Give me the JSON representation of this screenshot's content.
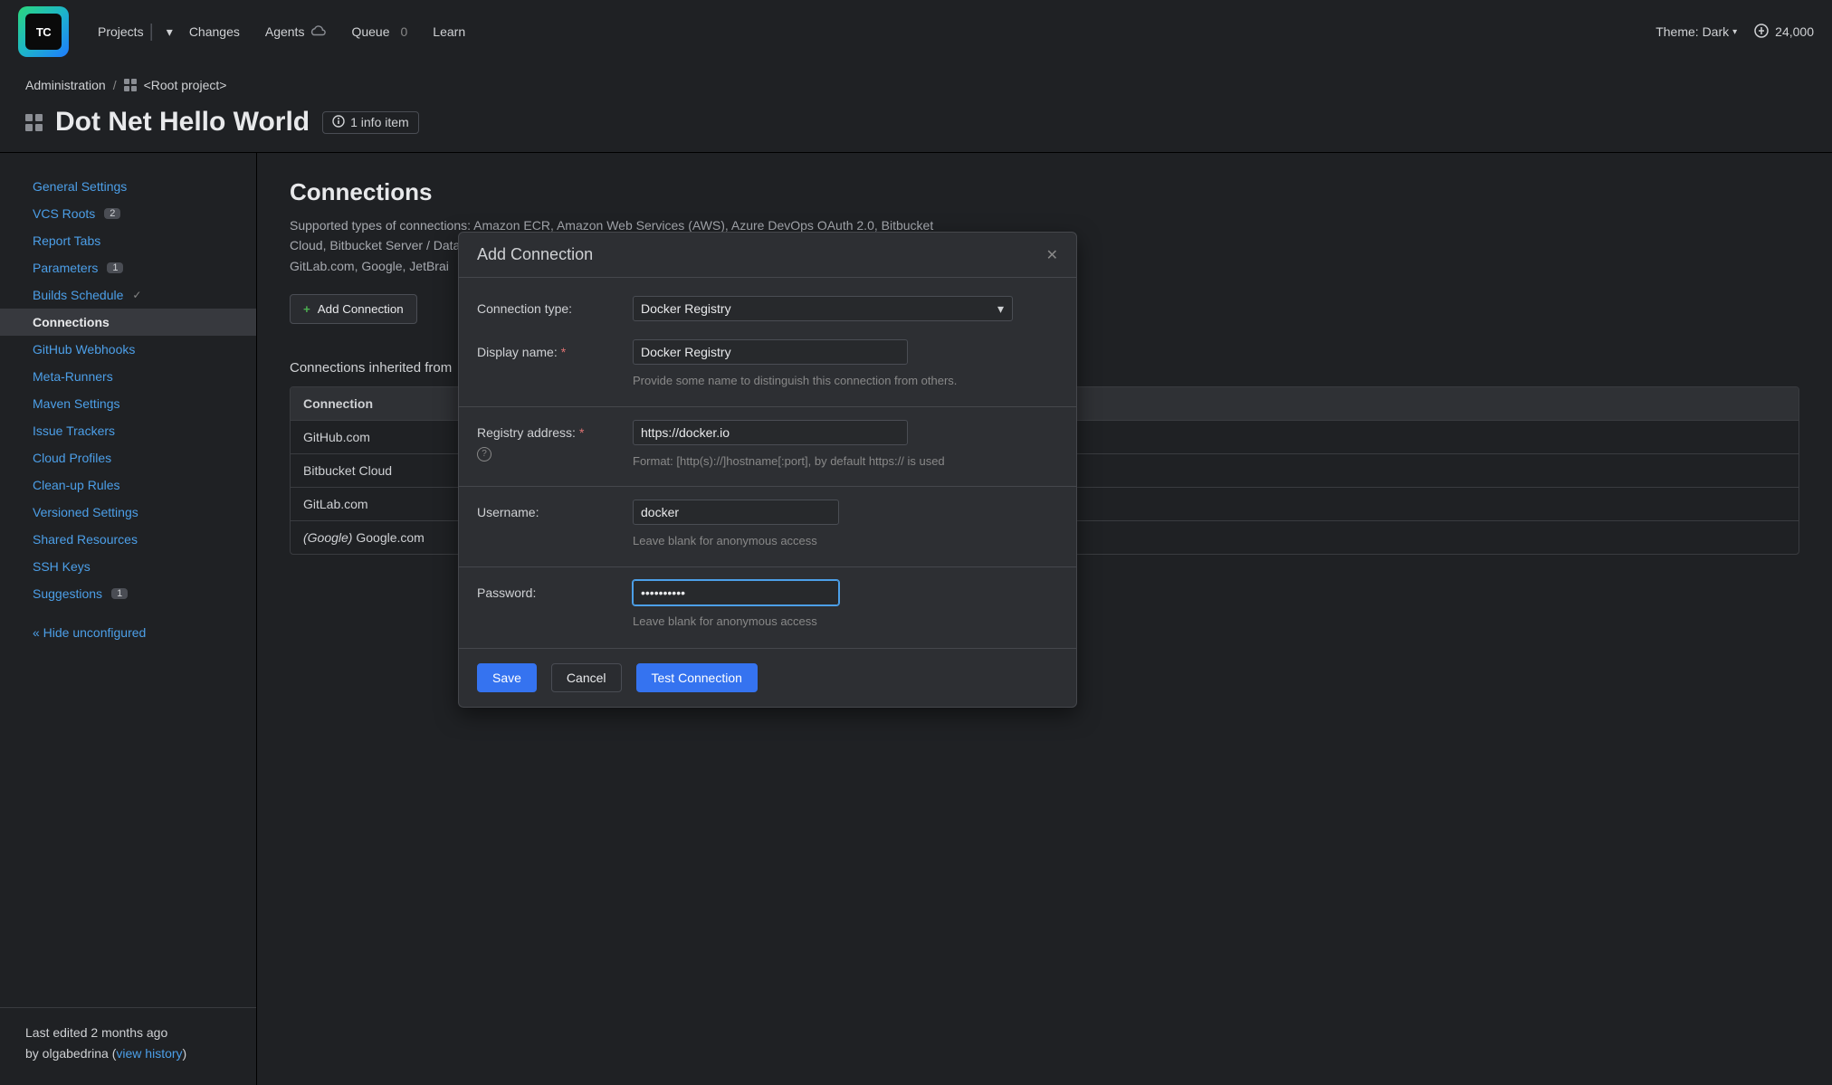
{
  "header": {
    "nav": {
      "projects": "Projects",
      "changes": "Changes",
      "agents": "Agents",
      "queue": "Queue",
      "queue_count": "0",
      "learn": "Learn"
    },
    "theme_label": "Theme: Dark",
    "credits": "24,000"
  },
  "breadcrumb": {
    "administration": "Administration",
    "root": "<Root project>"
  },
  "page": {
    "title": "Dot Net Hello World",
    "info_badge": "1 info item"
  },
  "sidebar": {
    "items": [
      {
        "label": "General Settings",
        "badge": ""
      },
      {
        "label": "VCS Roots",
        "badge": "2"
      },
      {
        "label": "Report Tabs",
        "badge": ""
      },
      {
        "label": "Parameters",
        "badge": "1"
      },
      {
        "label": "Builds Schedule",
        "badge": "",
        "check": true
      },
      {
        "label": "Connections",
        "badge": "",
        "active": true
      },
      {
        "label": "GitHub Webhooks",
        "badge": ""
      },
      {
        "label": "Meta-Runners",
        "badge": ""
      },
      {
        "label": "Maven Settings",
        "badge": ""
      },
      {
        "label": "Issue Trackers",
        "badge": ""
      },
      {
        "label": "Cloud Profiles",
        "badge": ""
      },
      {
        "label": "Clean-up Rules",
        "badge": ""
      },
      {
        "label": "Versioned Settings",
        "badge": ""
      },
      {
        "label": "Shared Resources",
        "badge": ""
      },
      {
        "label": "SSH Keys",
        "badge": ""
      },
      {
        "label": "Suggestions",
        "badge": "1"
      }
    ],
    "hide": "« Hide unconfigured",
    "footer": {
      "edited": "Last edited",
      "ago": "2 months ago",
      "by": "by olgabedrina  (",
      "view_history": "view history",
      "close": ")"
    }
  },
  "main": {
    "title": "Connections",
    "desc": "Supported types of connections: Amazon ECR, Amazon Web Services (AWS), Azure DevOps OAuth 2.0, Bitbucket Cloud, Bitbucket Server / Data DevOps PAT.",
    "desc_line2_frag": "GitLab.com, Google, JetBrai",
    "add_connection": "Add Connection",
    "inherited_title": "Connections inherited from",
    "table_header": "Connection",
    "rows": [
      {
        "label": "GitHub.com"
      },
      {
        "label": "Bitbucket Cloud"
      },
      {
        "label": "GitLab.com"
      },
      {
        "prefix": "(Google) ",
        "label": "Google.com"
      }
    ]
  },
  "modal": {
    "title": "Add Connection",
    "fields": {
      "type_label": "Connection type:",
      "type_value": "Docker Registry",
      "display_label": "Display name:",
      "display_value": "Docker Registry",
      "display_hint": "Provide some name to distinguish this connection from others.",
      "registry_label": "Registry address:",
      "registry_value": "https://docker.io",
      "registry_hint": "Format: [http(s)://]hostname[:port], by default https:// is used",
      "username_label": "Username:",
      "username_value": "docker",
      "username_hint": "Leave blank for anonymous access",
      "password_label": "Password:",
      "password_value": "••••••••••",
      "password_hint": "Leave blank for anonymous access"
    },
    "buttons": {
      "save": "Save",
      "cancel": "Cancel",
      "test": "Test Connection"
    }
  }
}
